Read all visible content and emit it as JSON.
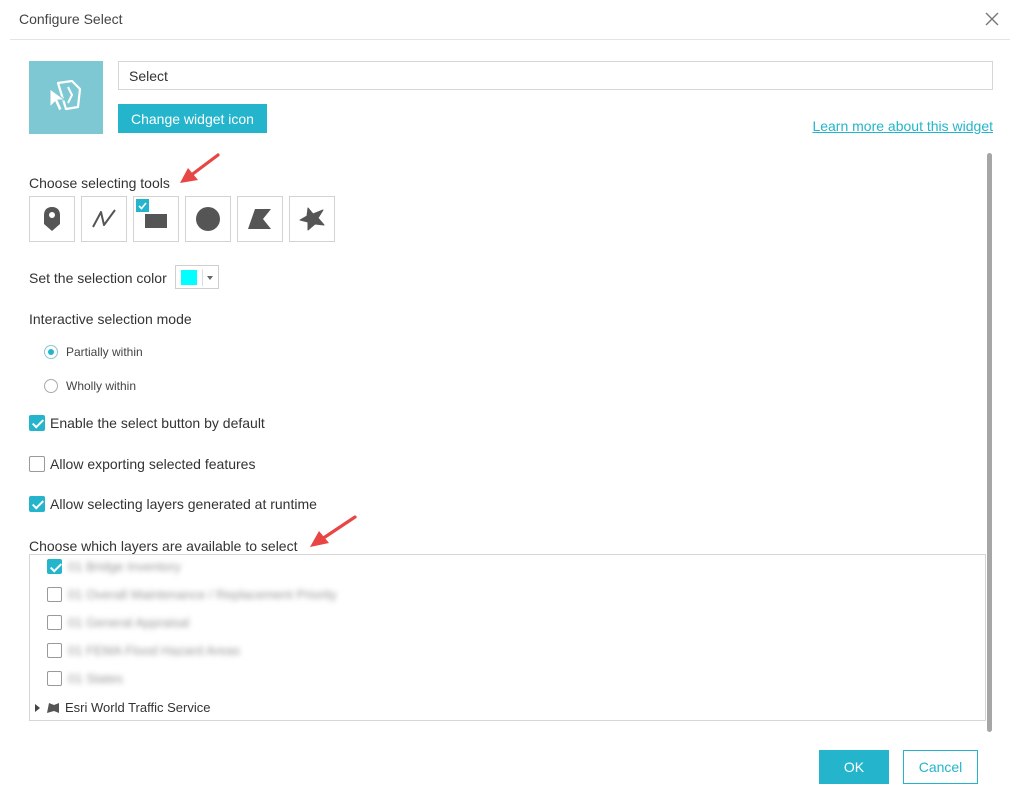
{
  "dialog": {
    "title": "Configure Select",
    "close_icon": "close-icon"
  },
  "widget": {
    "icon": "select-widget-icon",
    "icon_bg_color": "#7ec8d3",
    "name_value": "Select",
    "change_icon_label": "Change widget icon",
    "learn_more_label": "Learn more about this widget"
  },
  "tools": {
    "label": "Choose selecting tools",
    "items": [
      {
        "icon": "point-tool-icon",
        "checked": false
      },
      {
        "icon": "polyline-tool-icon",
        "checked": false
      },
      {
        "icon": "rectangle-tool-icon",
        "checked": true
      },
      {
        "icon": "circle-tool-icon",
        "checked": false
      },
      {
        "icon": "polygon-tool-icon",
        "checked": false
      },
      {
        "icon": "freehand-polygon-tool-icon",
        "checked": false
      }
    ]
  },
  "selection_color": {
    "label": "Set the selection color",
    "value": "#00ffff"
  },
  "mode": {
    "label": "Interactive selection mode",
    "options": [
      {
        "label": "Partially within",
        "selected": true
      },
      {
        "label": "Wholly within",
        "selected": false
      }
    ]
  },
  "options": [
    {
      "label": "Enable the select button by default",
      "checked": true
    },
    {
      "label": "Allow exporting selected features",
      "checked": false
    },
    {
      "label": "Allow selecting layers generated at runtime",
      "checked": true
    }
  ],
  "layers": {
    "label": "Choose which layers are available to select",
    "items": [
      {
        "name": "01 Bridge Inventory",
        "checked": true
      },
      {
        "name": "01 Overall Maintenance / Replacement Priority",
        "checked": false
      },
      {
        "name": "01 General Appraisal",
        "checked": false
      },
      {
        "name": "01 FEMA Flood Hazard Areas",
        "checked": false
      },
      {
        "name": "01 States",
        "checked": false
      }
    ],
    "group": {
      "name": "Esri World Traffic Service",
      "expanded": false
    }
  },
  "footer": {
    "ok_label": "OK",
    "cancel_label": "Cancel"
  },
  "colors": {
    "accent": "#24b5cc",
    "arrow": "#e84545"
  }
}
